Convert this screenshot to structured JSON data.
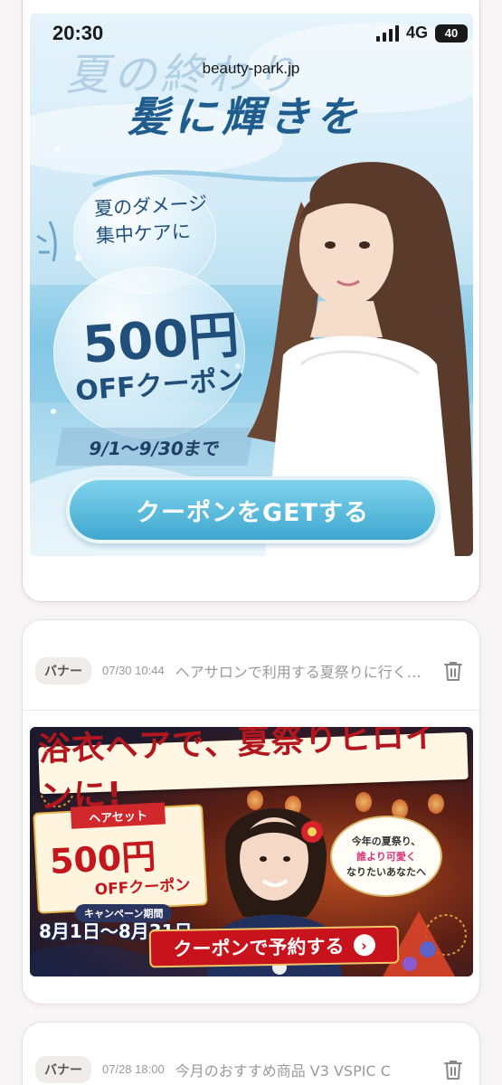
{
  "status_bar": {
    "time": "20:30",
    "network": "4G",
    "battery": "40"
  },
  "browser": {
    "url": "beauty-park.jp"
  },
  "banner1": {
    "headline_top": "夏の終わり",
    "headline_main": "髪に輝きを",
    "sub_line1": "夏のダメージ",
    "sub_line2": "集中ケアに",
    "amount": "500円",
    "off": "OFFクーポン",
    "period": "9/1〜9/30まで",
    "cta": "クーポンをGETする"
  },
  "cards": [
    {
      "tag": "バナー",
      "date": "07/30 10:44",
      "title": "ヘアサロンで利用する夏祭りに行く女性向けのバナー"
    },
    {
      "tag": "バナー",
      "date": "07/28 18:00",
      "title": "今月のおすすめ商品 V3 VSPIC C"
    }
  ],
  "banner2": {
    "headline": "浴衣ヘアで、夏祭りヒロインに!",
    "ribbon": "ヘアセット",
    "amount": "500円",
    "off": "OFFクーポン",
    "campaign_label": "キャンペーン期間",
    "campaign_dates": "8月1日〜8月31日",
    "speech_line1": "今年の夏祭り、",
    "speech_line2": "誰より可愛く",
    "speech_line3": "なりたいあなたへ",
    "cta": "クーポンで予約する"
  },
  "colors": {
    "accent_blue": "#3fa8d0",
    "accent_red": "#c8121c",
    "card_border": "#eadfe2"
  }
}
